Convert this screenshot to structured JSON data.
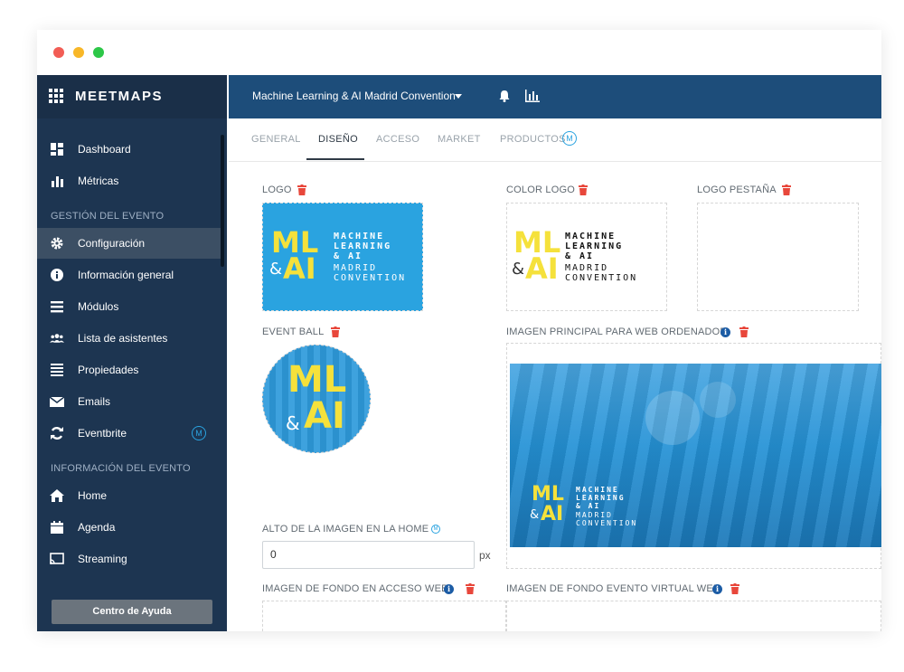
{
  "window": {
    "controls": [
      "close",
      "minimize",
      "maximize"
    ]
  },
  "brand": {
    "name": "MEETMAPS",
    "icon": "grid-icon"
  },
  "sidebar": {
    "items_top": [
      {
        "label": "Dashboard",
        "icon": "dashboard-icon"
      },
      {
        "label": "Métricas",
        "icon": "bar-chart-icon"
      }
    ],
    "section_event": "GESTIÓN DEL EVENTO",
    "items_event": [
      {
        "label": "Configuración",
        "icon": "gear-icon",
        "active": true
      },
      {
        "label": "Información general",
        "icon": "info-icon"
      },
      {
        "label": "Módulos",
        "icon": "list-icon"
      },
      {
        "label": "Lista de asistentes",
        "icon": "users-icon"
      },
      {
        "label": "Propiedades",
        "icon": "lines-icon"
      },
      {
        "label": "Emails",
        "icon": "mail-icon"
      },
      {
        "label": "Eventbrite",
        "icon": "refresh-icon",
        "badge": "M"
      }
    ],
    "section_info": "INFORMACIÓN DEL EVENTO",
    "items_info": [
      {
        "label": "Home",
        "icon": "home-icon"
      },
      {
        "label": "Agenda",
        "icon": "calendar-icon"
      },
      {
        "label": "Streaming",
        "icon": "cast-icon"
      }
    ],
    "help_button": "Centro de Ayuda"
  },
  "topbar": {
    "event_title": "Machine Learning & AI Madrid Convention"
  },
  "tabs": [
    {
      "label": "GENERAL"
    },
    {
      "label": "DISEÑO",
      "active": true
    },
    {
      "label": "ACCESO"
    },
    {
      "label": "MARKET"
    },
    {
      "label": "PRODUCTOS",
      "badge": "M"
    }
  ],
  "content": {
    "logo_label": "LOGO",
    "color_logo_label": "COLOR LOGO",
    "logo_tab_label": "LOGO PESTAÑA",
    "event_ball_label": "EVENT BALL",
    "main_image_label": "IMAGEN PRINCIPAL PARA WEB ORDENADOR",
    "home_height_label": "ALTO DE LA IMAGEN EN LA HOME",
    "home_height_value": "0",
    "home_height_unit": "px",
    "bg_access_label": "IMAGEN DE FONDO EN ACCESO WEB",
    "bg_virtual_label": "IMAGEN DE FONDO EVENTO VIRTUAL WEB",
    "brand_logo": {
      "ml": "ML",
      "amp": "&",
      "ai": "AI",
      "line1": "MACHINE",
      "line2": "LEARNING",
      "line3": "& AI",
      "line4": "MADRID",
      "line5": "CONVENTION"
    }
  },
  "colors": {
    "sidebar": "#1d3551",
    "topbar": "#1d4d7a",
    "accent": "#2aa3e0",
    "logo_yellow": "#f5e13b",
    "trash": "#e8473b"
  }
}
